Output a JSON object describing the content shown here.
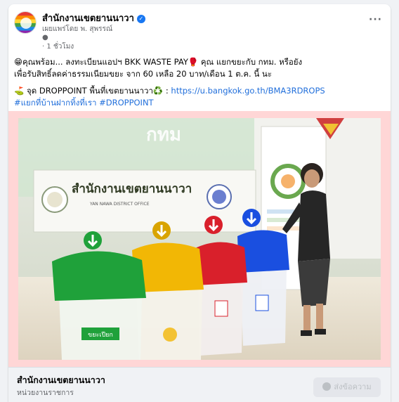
{
  "post": {
    "page_name": "สำนักงานเขตยานนาวา",
    "avatar_label": "ยานนาวา",
    "posted_by": "เผยแพร่โดย พ. สุพรรณ์",
    "time": "1 ชั่วโมง",
    "time_sep": "·",
    "body_line1": "😁คุณพร้อม... ลงทะเบียนแอปฯ BKK WASTE PAY🥊 คุณ แยกขยะกับ กทม. หรือยัง",
    "body_line2": "เพื่อรับสิทธิ์ลดค่าธรรมเนียมขยะ จาก 60 เหลือ 20 บาท/เดือน 1 ต.ค. นี้ นะ",
    "body_line3_prefix": "⛳ จุด DROPPOINT พื้นที่เขตยานนาวา♻️ : ",
    "body_link": "https://u.bangkok.go.th/BMA3RDROPS",
    "hashtags": "#แยกที่บ้านฝากทิ้งที่เรา #DROPPOINT",
    "photo": {
      "banner_title": "สำนักงานเขตยานนาวา",
      "banner_subtitle": "YAN NAWA DISTRICT OFFICE",
      "bma_text": "กทม",
      "bin_label_green": "ขยะเปียก",
      "colors": {
        "green": "#1fa13a",
        "yellow": "#f2b705",
        "red": "#d9202b",
        "blue": "#1a4fe0"
      }
    }
  },
  "footer": {
    "page_name": "สำนักงานเขตยานนาวา",
    "category": "หน่วยงานราชการ",
    "message_button": "ส่งข้อความ"
  },
  "icons": {
    "more": "more-icon",
    "verified": "verified-badge-icon",
    "globe": "globe-icon",
    "messenger": "messenger-icon"
  }
}
